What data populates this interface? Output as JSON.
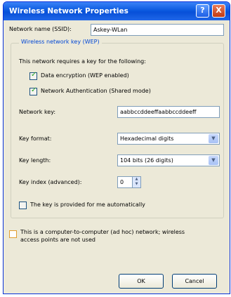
{
  "window": {
    "title": "Wireless Network Properties",
    "help_label": "?",
    "close_label": "X"
  },
  "ssid": {
    "label": "Network name (SSID):",
    "value": "Askey-WLan"
  },
  "wep_group": {
    "title": "Wireless network key (WEP)"
  },
  "key_intro": "This network requires a key for the following:",
  "data_encryption": {
    "label": "Data encryption (WEP enabled)",
    "checked": true
  },
  "network_auth": {
    "label": "Network Authentication (Shared mode)",
    "checked": true
  },
  "network_key": {
    "label": "Network key:",
    "value": "aabbccddeeffaabbccddeeff"
  },
  "key_format": {
    "label": "Key format:",
    "value": "Hexadecimal digits"
  },
  "key_length": {
    "label": "Key length:",
    "value": "104 bits (26 digits)"
  },
  "key_index": {
    "label": "Key index (advanced):",
    "value": "0"
  },
  "auto_key": {
    "label": "The key is provided for me automatically",
    "checked": false
  },
  "adhoc": {
    "line1": "This is a computer-to-computer (ad hoc) network; wireless",
    "line2": "access points are not used",
    "checked": false
  },
  "buttons": {
    "ok": "OK",
    "cancel": "Cancel"
  },
  "colors": {
    "titlebar": "#0b5ae0",
    "dialog_bg": "#ece9d8",
    "group_title": "#0046d5"
  },
  "icons": {
    "help": "help-icon",
    "close": "close-icon",
    "dropdown": "chevron-down-icon"
  }
}
